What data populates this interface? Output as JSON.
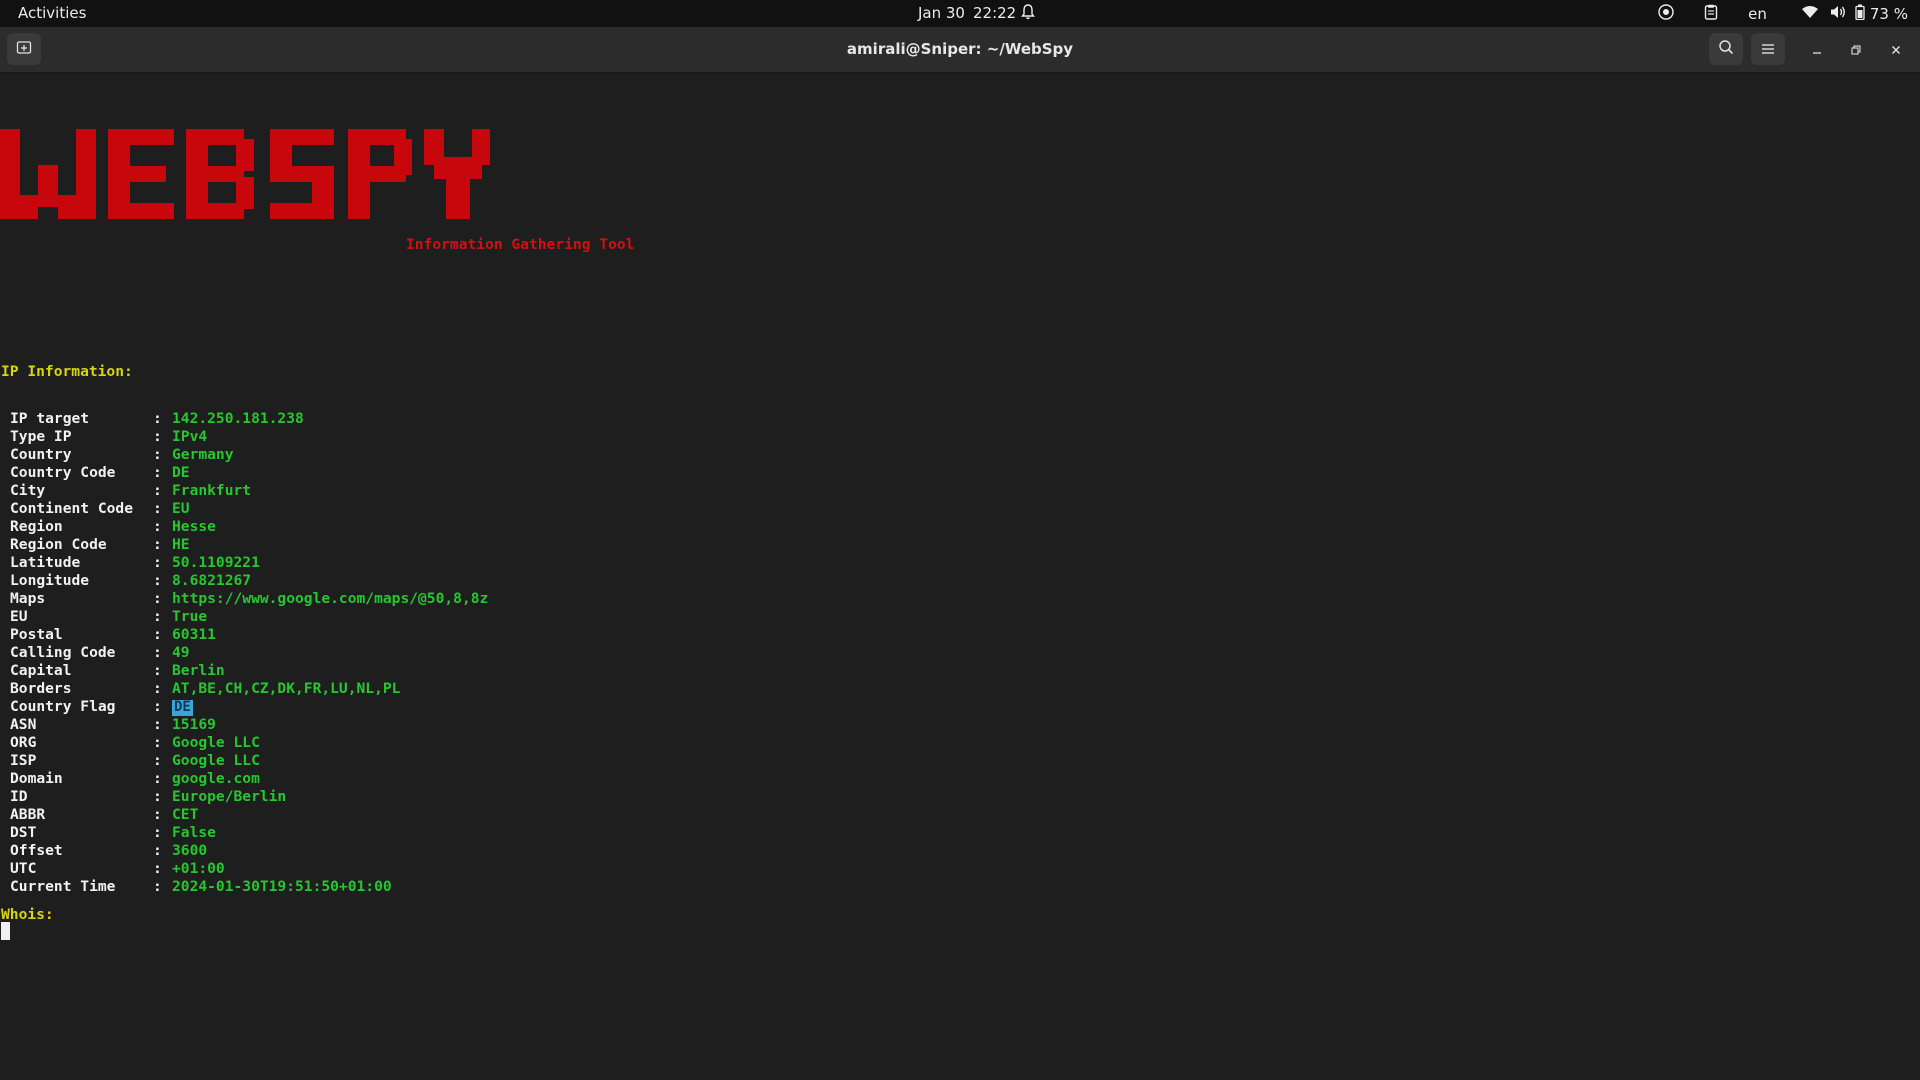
{
  "topbar": {
    "activities": "Activities",
    "date": "Jan 30",
    "time": "22:22",
    "language": "en",
    "battery": "73 %"
  },
  "window": {
    "title": "amirali@Sniper: ~/WebSpy"
  },
  "icons": {
    "new_tab": "new-tab-icon",
    "search": "search-icon",
    "menu": "hamburger-menu-icon",
    "minimize": "minimize-icon",
    "maximize": "maximize-icon",
    "close": "close-icon",
    "bell": "bell-icon",
    "wifi": "wifi-icon",
    "volume": "volume-icon",
    "battery": "battery-icon",
    "clipboard": "clipboard-icon",
    "help": "help-icon"
  },
  "terminal": {
    "banner": "WEB SPY",
    "subtitle": "Information Gathering Tool",
    "ip_header": "IP Information:",
    "whois_header": "Whois:",
    "rows": [
      {
        "key": "IP target",
        "value": "142.250.181.238"
      },
      {
        "key": "Type IP",
        "value": "IPv4"
      },
      {
        "key": "Country",
        "value": "Germany"
      },
      {
        "key": "Country Code",
        "value": "DE"
      },
      {
        "key": "City",
        "value": "Frankfurt"
      },
      {
        "key": "Continent Code",
        "value": "EU"
      },
      {
        "key": "Region",
        "value": "Hesse"
      },
      {
        "key": "Region Code",
        "value": "HE"
      },
      {
        "key": "Latitude",
        "value": "50.1109221"
      },
      {
        "key": "Longitude",
        "value": "8.6821267"
      },
      {
        "key": "Maps",
        "value": "https://www.google.com/maps/@50,8,8z"
      },
      {
        "key": "EU",
        "value": "True"
      },
      {
        "key": "Postal",
        "value": "60311"
      },
      {
        "key": "Calling Code",
        "value": "49"
      },
      {
        "key": "Capital",
        "value": "Berlin"
      },
      {
        "key": "Borders",
        "value": "AT,BE,CH,CZ,DK,FR,LU,NL,PL"
      },
      {
        "key": "Country Flag",
        "value": "DE",
        "flag": true
      },
      {
        "key": "ASN",
        "value": "15169"
      },
      {
        "key": "ORG",
        "value": "Google LLC"
      },
      {
        "key": "ISP",
        "value": "Google LLC"
      },
      {
        "key": "Domain",
        "value": "google.com"
      },
      {
        "key": "ID",
        "value": "Europe/Berlin"
      },
      {
        "key": "ABBR",
        "value": "CET"
      },
      {
        "key": "DST",
        "value": "False"
      },
      {
        "key": "Offset",
        "value": "3600"
      },
      {
        "key": "UTC",
        "value": "+01:00"
      },
      {
        "key": "Current Time",
        "value": "2024-01-30T19:51:50+01:00"
      }
    ],
    "colors": {
      "banner": "#c8070d",
      "subtitle": "#d11111",
      "header": "#d7d414",
      "key": "#f2f2f2",
      "value": "#26c72f",
      "background": "#1e1e1e"
    }
  }
}
